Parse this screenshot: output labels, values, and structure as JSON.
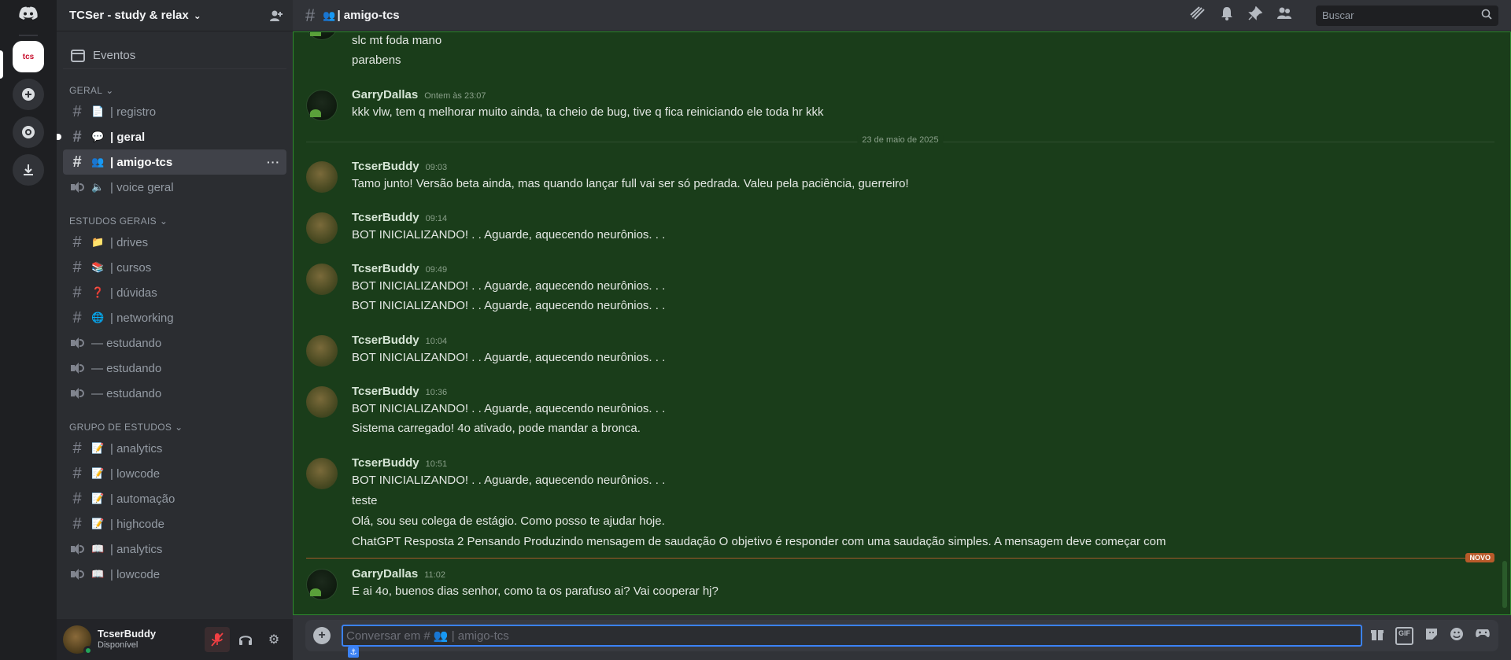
{
  "server": {
    "name": "TCSer - study & relax",
    "logo_text": "tcs",
    "events_label": "Eventos"
  },
  "categories": [
    {
      "label": "GERAL",
      "channels": [
        {
          "type": "text",
          "emoji": "📄",
          "label": "| registro"
        },
        {
          "type": "text",
          "emoji": "💬",
          "label": "| geral"
        },
        {
          "type": "text",
          "emoji": "👥",
          "label": "| amigo-tcs"
        },
        {
          "type": "voice",
          "emoji": "🔈",
          "label": "| voice geral"
        }
      ]
    },
    {
      "label": "ESTUDOS GERAIS",
      "channels": [
        {
          "type": "text",
          "emoji": "📁",
          "label": "| drives"
        },
        {
          "type": "text",
          "emoji": "📚",
          "label": "| cursos"
        },
        {
          "type": "text",
          "emoji": "❓",
          "label": "| dúvidas"
        },
        {
          "type": "text",
          "emoji": "🌐",
          "label": "| networking"
        },
        {
          "type": "voice",
          "emoji": "",
          "label": "— estudando"
        },
        {
          "type": "voice",
          "emoji": "",
          "label": "— estudando"
        },
        {
          "type": "voice",
          "emoji": "",
          "label": "— estudando"
        }
      ]
    },
    {
      "label": "GRUPO DE ESTUDOS",
      "channels": [
        {
          "type": "text",
          "emoji": "📝",
          "label": "| analytics"
        },
        {
          "type": "text",
          "emoji": "📝",
          "label": "| lowcode"
        },
        {
          "type": "text",
          "emoji": "📝",
          "label": "| automação"
        },
        {
          "type": "text",
          "emoji": "📝",
          "label": "| highcode"
        },
        {
          "type": "voice",
          "emoji": "📖",
          "label": "| analytics"
        },
        {
          "type": "voice",
          "emoji": "📖",
          "label": "| lowcode"
        }
      ]
    }
  ],
  "user": {
    "name": "TcserBuddy",
    "status": "Disponível"
  },
  "channel_header": {
    "emoji": "👥",
    "title": "| amigo-tcs",
    "search_placeholder": "Buscar"
  },
  "messages": {
    "m0": {
      "lines": [
        "slc mt foda mano",
        "parabens"
      ]
    },
    "m1": {
      "author": "GarryDallas",
      "time": "Ontem às 23:07",
      "lines": [
        "kkk vlw, tem q melhorar muito ainda, ta cheio de bug, tive q fica reiniciando ele toda hr kkk"
      ]
    },
    "date_divider": "23 de maio de 2025",
    "m2": {
      "author": "TcserBuddy",
      "time": "09:03",
      "lines": [
        "Tamo junto! Versão beta ainda, mas quando lançar full vai ser só pedrada. Valeu pela paciência, guerreiro!"
      ]
    },
    "m3": {
      "author": "TcserBuddy",
      "time": "09:14",
      "lines": [
        "BOT INICIALIZANDO! . . Aguarde, aquecendo neurônios. . ."
      ]
    },
    "m4": {
      "author": "TcserBuddy",
      "time": "09:49",
      "lines": [
        "BOT INICIALIZANDO! . . Aguarde, aquecendo neurônios. . .",
        "BOT INICIALIZANDO! . . Aguarde, aquecendo neurônios. . ."
      ]
    },
    "m5": {
      "author": "TcserBuddy",
      "time": "10:04",
      "lines": [
        "BOT INICIALIZANDO! . . Aguarde, aquecendo neurônios. . ."
      ]
    },
    "m6": {
      "author": "TcserBuddy",
      "time": "10:36",
      "lines": [
        "BOT INICIALIZANDO! . . Aguarde, aquecendo neurônios. . .",
        "Sistema carregado! 4o ativado, pode mandar a bronca."
      ]
    },
    "m7": {
      "author": "TcserBuddy",
      "time": "10:51",
      "lines": [
        "BOT INICIALIZANDO! . . Aguarde, aquecendo neurônios. . .",
        "teste",
        "Olá, sou seu colega de estágio. Como posso te ajudar hoje.",
        "ChatGPT Resposta 2 Pensando Produzindo mensagem de saudação O objetivo é responder com uma saudação simples. A mensagem deve começar com"
      ]
    },
    "new_label": "NOVO",
    "m8": {
      "author": "GarryDallas",
      "time": "11:02",
      "lines": [
        "E ai 4o, buenos dias senhor, como ta os parafuso ai? Vai cooperar hj?"
      ]
    }
  },
  "composer": {
    "placeholder": "Conversar em # 👥 | amigo-tcs",
    "gif_label": "GIF"
  },
  "colors": {
    "chat_bg": "#1a3d1a",
    "chat_border": "#2f8a2f",
    "active_channel": "#404249",
    "mute_red": "#f23f43",
    "online_green": "#23a55a",
    "new_divider": "#b85a2a"
  }
}
